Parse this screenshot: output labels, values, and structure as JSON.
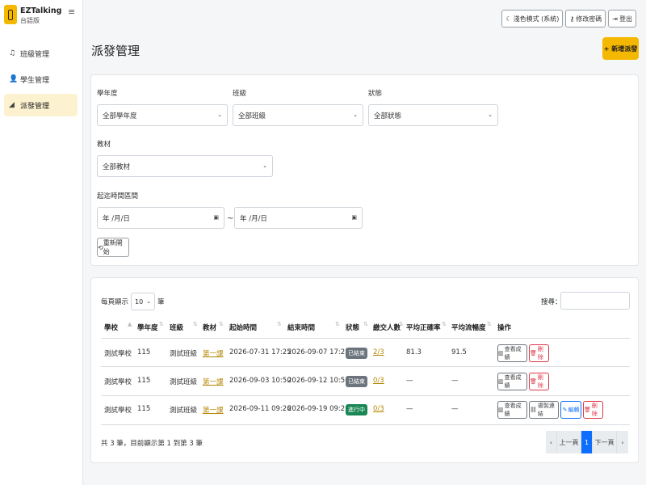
{
  "brand": {
    "name": "EZTalking",
    "subtitle": "台語版",
    "menu_icon": "hamburger-icon"
  },
  "sidebar": {
    "items": [
      {
        "label": "班級管理",
        "icon": "music-icon",
        "active": false
      },
      {
        "label": "學生管理",
        "icon": "user-icon",
        "active": false
      },
      {
        "label": "派發管理",
        "icon": "send-icon",
        "active": true
      }
    ]
  },
  "topbar": {
    "theme_label": "淺色模式 (系統)",
    "password_label": "修改密碼",
    "logout_label": "登出"
  },
  "page": {
    "title": "派發管理",
    "add_label": "+ 新增派發"
  },
  "filters": {
    "year": {
      "label": "學年度",
      "value": "全部學年度"
    },
    "class": {
      "label": "班級",
      "value": "全部班級"
    },
    "status": {
      "label": "狀態",
      "value": "全部狀態"
    },
    "material": {
      "label": "教材",
      "value": "全部教材"
    },
    "date_range": {
      "label": "起迄時間區間",
      "start": "年 /月/日",
      "end": "年 /月/日",
      "separator": "~"
    },
    "reset_label": "重新開始"
  },
  "table": {
    "length": {
      "prefix": "每頁顯示",
      "value": "10",
      "suffix": "筆"
    },
    "search_label": "搜尋：",
    "columns": [
      "學校",
      "學年度",
      "班級",
      "教材",
      "起始時間",
      "結束時間",
      "狀態",
      "繳交人數",
      "平均正確率",
      "平均流暢度",
      "操作"
    ],
    "rows": [
      {
        "school": "測試學校",
        "year": "115",
        "class": "測試班級",
        "material": "第一課",
        "start": "2026-07-31 17:25",
        "end": "2026-09-07 17:25",
        "status": "已結束",
        "status_type": "ended",
        "submitted": "2/3",
        "accuracy": "81.3",
        "fluency": "91.5",
        "actions": [
          {
            "label": "查看成績",
            "style": "grey",
            "icon": "chart-icon"
          },
          {
            "label": "刪除",
            "style": "red",
            "icon": "trash-icon"
          }
        ]
      },
      {
        "school": "測試學校",
        "year": "115",
        "class": "測試班級",
        "material": "第一課",
        "start": "2026-09-03 10:50",
        "end": "2026-09-12 10:50",
        "status": "已結束",
        "status_type": "ended",
        "submitted": "0/3",
        "accuracy": "—",
        "fluency": "—",
        "actions": [
          {
            "label": "查看成績",
            "style": "grey",
            "icon": "chart-icon"
          },
          {
            "label": "刪除",
            "style": "red",
            "icon": "trash-icon"
          }
        ]
      },
      {
        "school": "測試學校",
        "year": "115",
        "class": "測試班級",
        "material": "第一課",
        "start": "2026-09-11 09:26",
        "end": "2026-09-19 09:26",
        "status": "進行中",
        "status_type": "ongoing",
        "submitted": "0/3",
        "accuracy": "—",
        "fluency": "—",
        "actions": [
          {
            "label": "查看成績",
            "style": "grey",
            "icon": "chart-icon"
          },
          {
            "label": "複製連結",
            "style": "grey",
            "icon": "link-icon"
          },
          {
            "label": "編輯",
            "style": "blue",
            "icon": "pencil-icon"
          },
          {
            "label": "刪除",
            "style": "red",
            "icon": "trash-icon"
          }
        ]
      }
    ],
    "info": "共 3 筆，目前顯示第 1 到第 3 筆",
    "pagination": {
      "first": "‹",
      "prev": "上一頁",
      "current": "1",
      "next": "下一頁",
      "last": "›"
    }
  },
  "colors": {
    "accent": "#f5b800",
    "ended": "#6c757d",
    "ongoing": "#198754",
    "danger": "#dc3545",
    "primary": "#0d6efd"
  }
}
